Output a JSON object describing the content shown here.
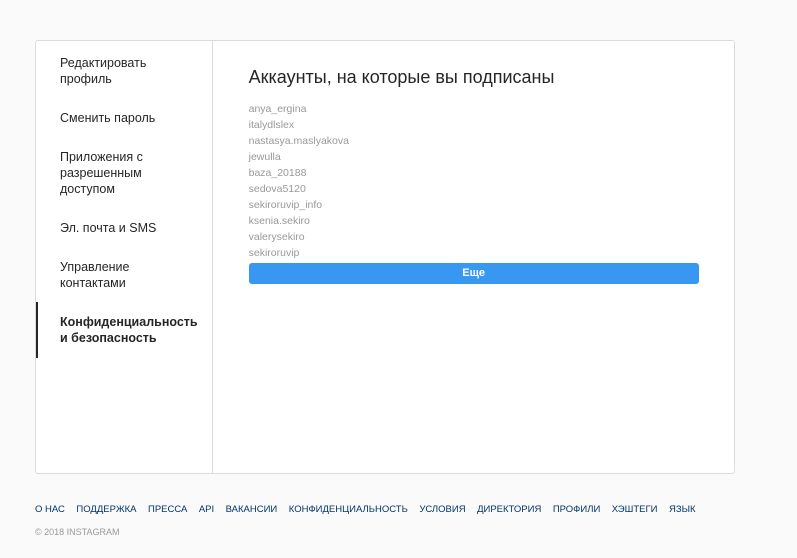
{
  "sidebar": {
    "items": [
      {
        "label": "Редактировать профиль"
      },
      {
        "label": "Сменить пароль"
      },
      {
        "label": "Приложения с разрешенным доступом"
      },
      {
        "label": "Эл. почта и SMS"
      },
      {
        "label": "Управление контактами"
      },
      {
        "label": "Конфиденциальность и безопасность",
        "active": true
      }
    ]
  },
  "main": {
    "title": "Аккаунты, на которые вы подписаны",
    "accounts": [
      "anya_ergina",
      "italydlslex",
      "nastasya.maslyakova",
      "jewulla",
      "baza_20188",
      "sedova5120",
      "sekiroruvip_info",
      "ksenia.sekiro",
      "valerysekiro",
      "sekiroruvip"
    ],
    "more_label": "Еще"
  },
  "footer": {
    "links": [
      "О НАС",
      "ПОДДЕРЖКА",
      "ПРЕССА",
      "API",
      "ВАКАНСИИ",
      "КОНФИДЕНЦИАЛЬНОСТЬ",
      "УСЛОВИЯ",
      "ДИРЕКТОРИЯ",
      "ПРОФИЛИ",
      "ХЭШТЕГИ",
      "ЯЗЫК"
    ],
    "copyright": "© 2018 INSTAGRAM"
  },
  "colors": {
    "accent": "#3897f0",
    "link": "#003569",
    "muted": "#999999",
    "border": "#dbdbdb"
  }
}
